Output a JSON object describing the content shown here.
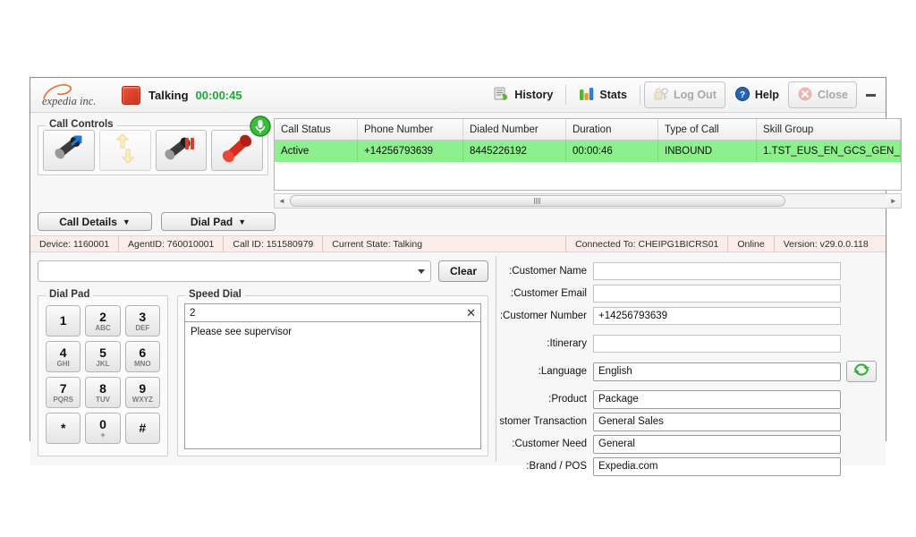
{
  "titlebar": {
    "brand": "expedia inc.",
    "status_label": "Talking",
    "timer": "00:00:45",
    "status_color": "#d43b22",
    "timer_color": "#1faa38",
    "minimize_icon": "minimize-icon"
  },
  "toolbar": {
    "history": "History",
    "stats": "Stats",
    "logout": "Log Out",
    "help": "Help",
    "close": "Close"
  },
  "call_controls": {
    "legend": "Call Controls",
    "buttons": [
      {
        "name": "transfer-call-button",
        "icon": "handset-transfer-icon",
        "enabled": true
      },
      {
        "name": "conference-call-button",
        "icon": "conference-arrows-icon",
        "enabled": false
      },
      {
        "name": "hold-call-button",
        "icon": "handset-pause-icon",
        "enabled": true
      },
      {
        "name": "end-call-button",
        "icon": "red-handset-icon",
        "enabled": true
      }
    ],
    "mic_icon": "microphone-icon"
  },
  "call_grid": {
    "columns": [
      "Call Status",
      "Phone Number",
      "Dialed Number",
      "Duration",
      "Type of Call",
      "Skill Group"
    ],
    "rows": [
      {
        "call_status": "Active",
        "phone_number": "+14256793639",
        "dialed_number": "8445226192",
        "duration": "00:00:46",
        "type_of_call": "INBOUND",
        "skill_group": "1.TST_EUS_EN_GCS_GEN_"
      }
    ],
    "row_highlight_color": "#8cf08c",
    "scrollbar": {
      "left_arrow": "◄",
      "right_arrow": "►"
    }
  },
  "toggles": {
    "call_details": "Call Details",
    "dial_pad": "Dial Pad",
    "caret": "▼"
  },
  "status_strip": {
    "device": "Device: 1160001",
    "agent_id": "AgentID: 760010001",
    "call_id": "Call ID: 151580979",
    "current_state": "Current State: Talking",
    "connected_to": "Connected To: CHEIPG1BICRS01",
    "online": "Online",
    "version": "Version: v29.0.0.118"
  },
  "dial_area": {
    "combo_value": "",
    "combo_placeholder": "",
    "clear_label": "Clear",
    "dialpad_legend": "Dial Pad",
    "keys": [
      {
        "num": "1",
        "sub": ""
      },
      {
        "num": "2",
        "sub": "ABC"
      },
      {
        "num": "3",
        "sub": "DEF"
      },
      {
        "num": "4",
        "sub": "GHI"
      },
      {
        "num": "5",
        "sub": "JKL"
      },
      {
        "num": "6",
        "sub": "MNO"
      },
      {
        "num": "7",
        "sub": "PQRS"
      },
      {
        "num": "8",
        "sub": "TUV"
      },
      {
        "num": "9",
        "sub": "WXYZ"
      },
      {
        "num": "*",
        "sub": ""
      },
      {
        "num": "0",
        "sub": "+"
      },
      {
        "num": "#",
        "sub": ""
      }
    ]
  },
  "speed_dial": {
    "legend": "Speed Dial",
    "search_value": "2",
    "clear_icon": "✕",
    "entries": [
      "Please see supervisor"
    ]
  },
  "customer_form": {
    "fields": [
      {
        "label": "Customer Name:",
        "value": "",
        "type": "input",
        "name": "customer-name-field"
      },
      {
        "label": "Customer Email:",
        "value": "",
        "type": "input",
        "name": "customer-email-field"
      },
      {
        "label": "Customer Number:",
        "value": "+14256793639",
        "type": "input",
        "name": "customer-number-field"
      },
      {
        "label": "Itinerary:",
        "value": "",
        "type": "input",
        "name": "itinerary-field"
      },
      {
        "label": "Language:",
        "value": "English",
        "type": "combo",
        "name": "language-select"
      },
      {
        "label": "Product:",
        "value": "Package",
        "type": "combo",
        "name": "product-select"
      },
      {
        "label": "Customer Transaction:",
        "value": "General Sales",
        "type": "combo",
        "name": "customer-transaction-select"
      },
      {
        "label": "Customer Need:",
        "value": "General",
        "type": "combo",
        "name": "customer-need-select"
      },
      {
        "label": "Brand / POS:",
        "value": "Expedia.com",
        "type": "combo",
        "name": "brand-pos-select"
      }
    ],
    "refresh_icon": "refresh-icon"
  }
}
